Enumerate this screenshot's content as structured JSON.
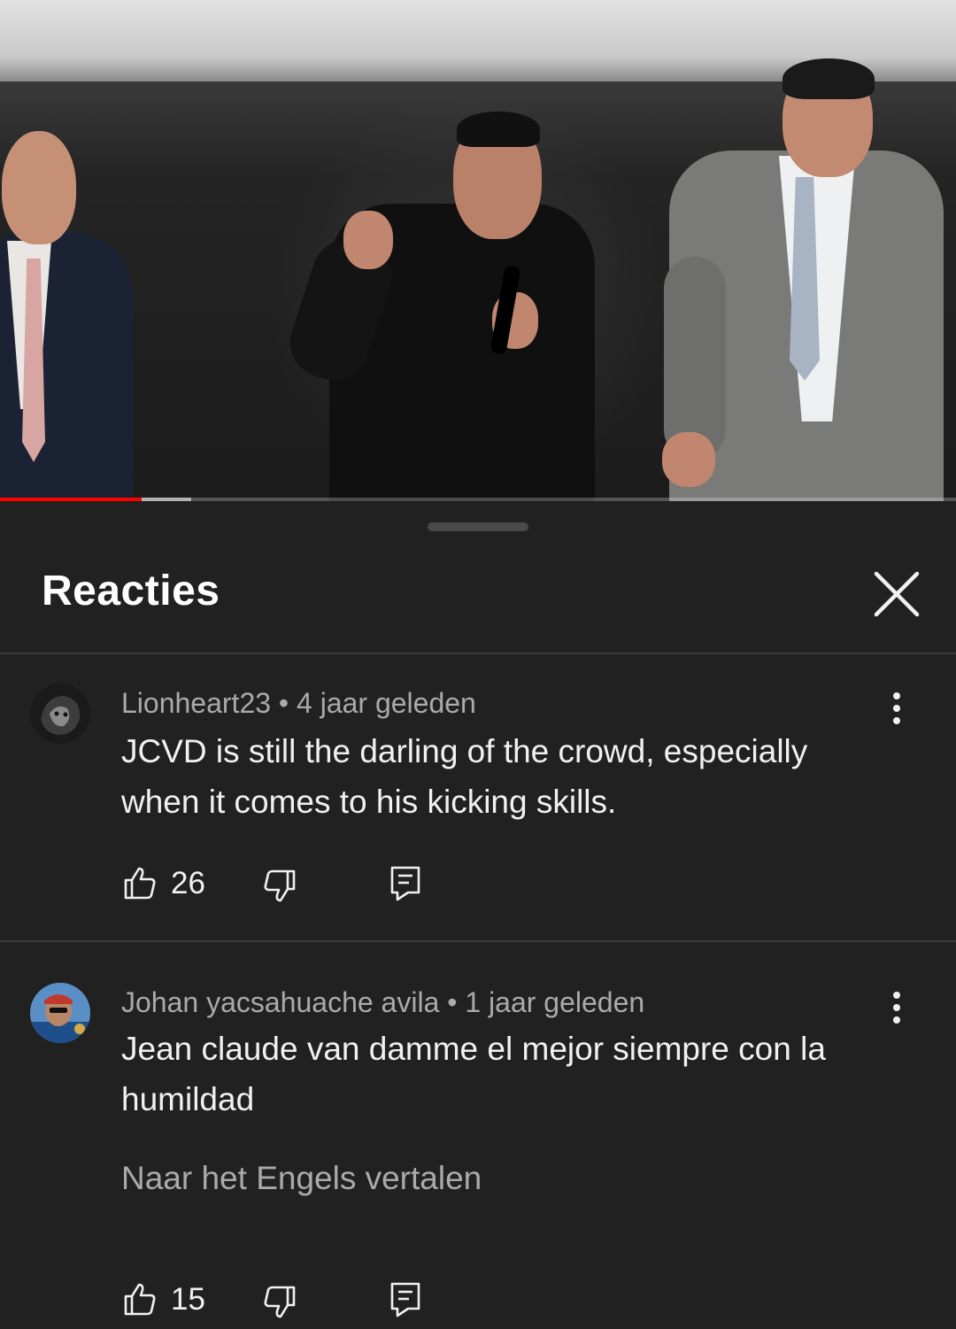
{
  "sheet": {
    "title": "Reacties"
  },
  "video": {
    "progress_played_fraction": 0.148,
    "progress_buffered_fraction": 0.2
  },
  "comments": [
    {
      "author": "Lionheart23",
      "separator": "•",
      "time": "4 jaar geleden",
      "text": "JCVD is still the darling of the crowd, especially when it comes to his kicking skills.",
      "likes": "26",
      "translate_label": ""
    },
    {
      "author": "Johan yacsahuache avila",
      "separator": "•",
      "time": "1 jaar geleden",
      "text": "Jean claude van damme el mejor siempre con la humildad",
      "likes": "15",
      "translate_label": "Naar het Engels vertalen"
    }
  ],
  "icons": {
    "close": "close-icon",
    "more": "more-vert-icon",
    "like": "thumb-up-icon",
    "dislike": "thumb-down-icon",
    "reply": "reply-icon"
  },
  "colors": {
    "background": "#212121",
    "progress_played": "#ff0000",
    "secondary_text": "#aaaaaa"
  }
}
